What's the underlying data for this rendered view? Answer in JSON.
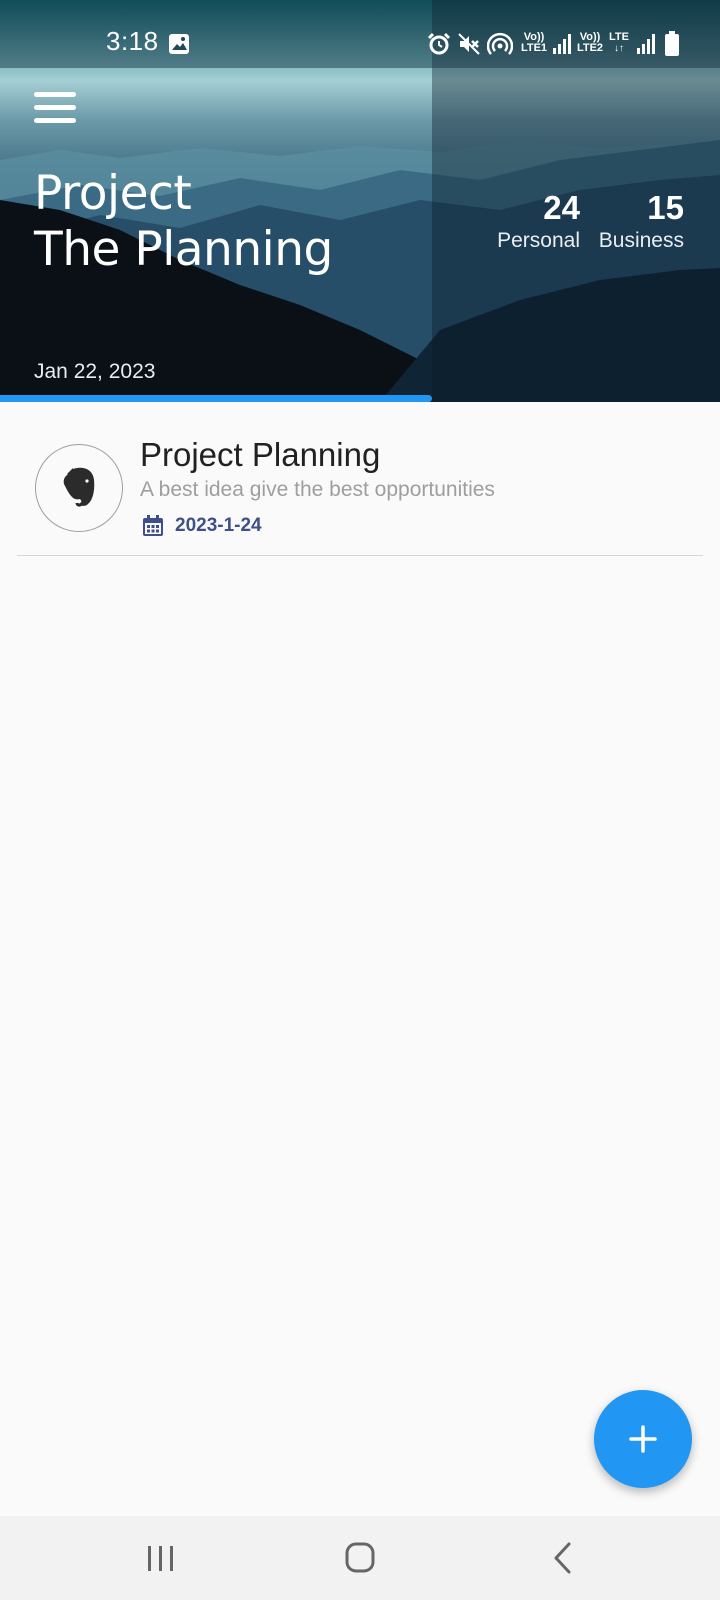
{
  "status_bar": {
    "time": "3:18",
    "sim1_label_top": "Vo))",
    "sim1_label_bottom": "LTE1",
    "sim2_label_top": "Vo))",
    "sim2_label_bottom": "LTE2",
    "network_label": "LTE",
    "icons": [
      "image-icon",
      "alarm-icon",
      "mute-icon",
      "hotspot-icon",
      "signal-icon",
      "signal-icon",
      "signal-icon",
      "battery-icon"
    ]
  },
  "header": {
    "title_line1": "Project",
    "title_line2": "The Planning",
    "stats": [
      {
        "value": "24",
        "label": "Personal"
      },
      {
        "value": "15",
        "label": "Business"
      }
    ],
    "date": "Jan 22, 2023",
    "progress_fraction": 0.6,
    "progress_color": "#2196f3"
  },
  "tasks": [
    {
      "title": "Project Planning",
      "subtitle": "A best idea give the best opportunities",
      "date": "2023-1-24",
      "icon": "evernote-elephant-icon"
    }
  ],
  "fab": {
    "icon": "plus-icon",
    "color": "#2196f3"
  },
  "nav_bar": {
    "buttons": [
      "recent-apps-icon",
      "home-icon",
      "back-icon"
    ]
  }
}
